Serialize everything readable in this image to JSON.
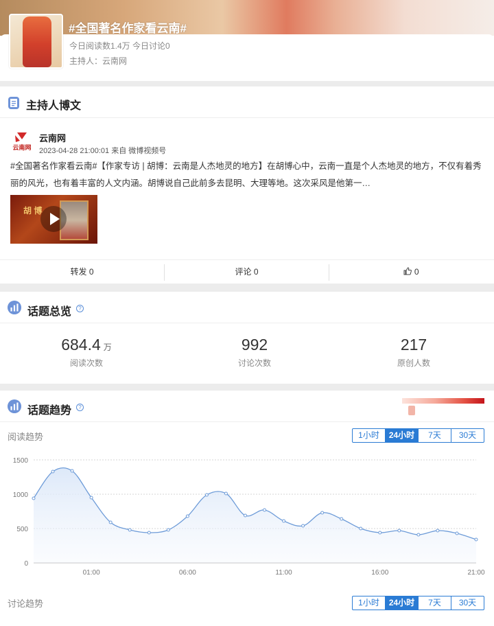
{
  "topic": {
    "title": "#全国著名作家看云南#",
    "stats": "今日阅读数1.4万 今日讨论0",
    "host": "主持人：云南网"
  },
  "host_post": {
    "section_title": "主持人博文",
    "author": "云南网",
    "avatar_text": "云南网",
    "meta": "2023-04-28 21:00:01 来自 微博视频号",
    "text": "#全国著名作家看云南#【作家专访 | 胡博：云南是人杰地灵的地方】在胡博心中，云南一直是个人杰地灵的地方，不仅有着秀丽的风光，也有着丰富的人文内涵。胡博说自己此前多去昆明、大理等地。这次采风是他第一…",
    "video_label": "胡 博",
    "repost": "转发 0",
    "comment": "评论 0",
    "like": "0"
  },
  "overview": {
    "section_title": "话题总览",
    "items": [
      {
        "value": "684.4",
        "unit": "万",
        "label": "阅读次数"
      },
      {
        "value": "992",
        "unit": "",
        "label": "讨论次数"
      },
      {
        "value": "217",
        "unit": "",
        "label": "原创人数"
      }
    ]
  },
  "trend": {
    "section_title": "话题趋势",
    "read_label": "阅读趋势",
    "discuss_label": "讨论趋势",
    "ranges": [
      "1小时",
      "24小时",
      "7天",
      "30天"
    ],
    "selected_range": "24小时",
    "colors": {
      "line": "#6d9bd8",
      "accent": "#2a7bd4"
    }
  },
  "chart_data": {
    "type": "area",
    "title": "阅读趋势",
    "xlabel": "",
    "ylabel": "",
    "ylim": [
      0,
      1500
    ],
    "yticks": [
      0,
      500,
      1000,
      1500
    ],
    "xticks": [
      "01:00",
      "06:00",
      "11:00",
      "16:00",
      "21:00"
    ],
    "x": [
      "22:00",
      "23:00",
      "00:00",
      "01:00",
      "02:00",
      "03:00",
      "04:00",
      "05:00",
      "06:00",
      "07:00",
      "08:00",
      "09:00",
      "10:00",
      "11:00",
      "12:00",
      "13:00",
      "14:00",
      "15:00",
      "16:00",
      "17:00",
      "18:00",
      "19:00",
      "20:00",
      "21:00"
    ],
    "values": [
      940,
      1330,
      1340,
      950,
      590,
      480,
      440,
      480,
      680,
      990,
      1010,
      690,
      770,
      610,
      540,
      730,
      640,
      500,
      440,
      470,
      410,
      470,
      430,
      340
    ],
    "grid": true
  }
}
